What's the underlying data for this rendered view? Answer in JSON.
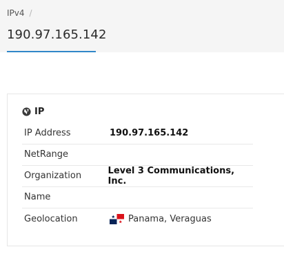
{
  "breadcrumb": {
    "item": "IPv4",
    "separator": "/"
  },
  "page": {
    "title": "190.97.165.142"
  },
  "card": {
    "icon": "globe-icon",
    "title": "IP",
    "rows": [
      {
        "label": "IP Address",
        "value": "190.97.165.142"
      },
      {
        "label": "NetRange",
        "value": ""
      },
      {
        "label": "Organization",
        "value": "Level 3 Communications, Inc."
      },
      {
        "label": "Name",
        "value": ""
      },
      {
        "label": "Geolocation",
        "value": "Panama, Veraguas",
        "flag": "panama-flag-icon"
      }
    ]
  },
  "colors": {
    "accent": "#2f86c8",
    "header_background": "#f5f5f5",
    "row_divider": "#e8e8e8"
  }
}
